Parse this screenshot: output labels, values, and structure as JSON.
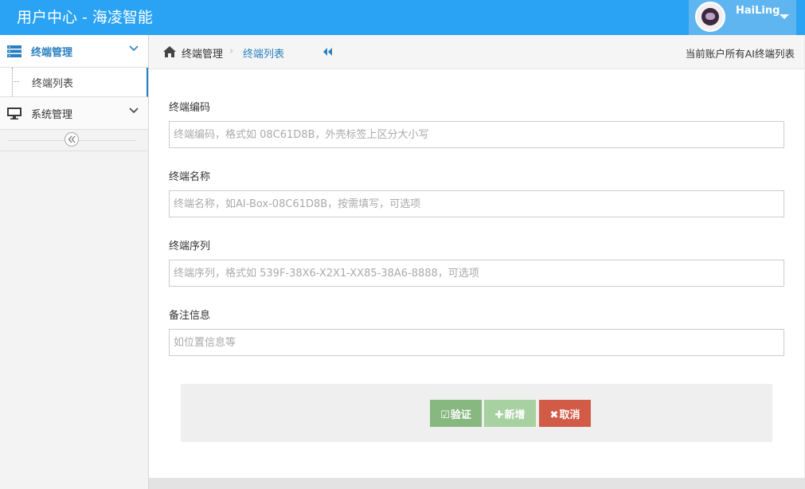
{
  "header": {
    "title": "用户中心 - 海凌智能",
    "user": {
      "name": "HaiLing"
    }
  },
  "sidebar": {
    "groups": [
      {
        "label": "终端管理",
        "icon": "server-icon",
        "active": true,
        "children": [
          {
            "label": "终端列表"
          }
        ]
      },
      {
        "label": "系统管理",
        "icon": "monitor-icon",
        "active": false
      }
    ]
  },
  "breadcrumb": {
    "items": [
      "终端管理",
      "终端列表"
    ],
    "separator": "›",
    "info": "当前账户所有AI终端列表"
  },
  "form": {
    "fields": [
      {
        "label": "终端编码",
        "value": "",
        "placeholder": "终端编码，格式如 08C61D8B，外壳标签上区分大小写"
      },
      {
        "label": "终端名称",
        "value": "",
        "placeholder": "终端名称，如AI-Box-08C61D8B，按需填写，可选项"
      },
      {
        "label": "终端序列",
        "value": "",
        "placeholder": "终端序列，格式如 539F-38X6-X2X1-XX85-38A6-8888，可选项"
      },
      {
        "label": "备注信息",
        "value": "",
        "placeholder": "如位置信息等"
      }
    ]
  },
  "actions": {
    "verify": {
      "icon": "☑",
      "label": "验证",
      "color": "#87b87f"
    },
    "add": {
      "icon": "✚",
      "label": "新增",
      "color": "#a7d1a0"
    },
    "cancel": {
      "icon": "✖",
      "label": "取消",
      "color": "#d15b47"
    }
  },
  "colors": {
    "header": "#2aa3f4",
    "accent": "#2a7fc0"
  }
}
